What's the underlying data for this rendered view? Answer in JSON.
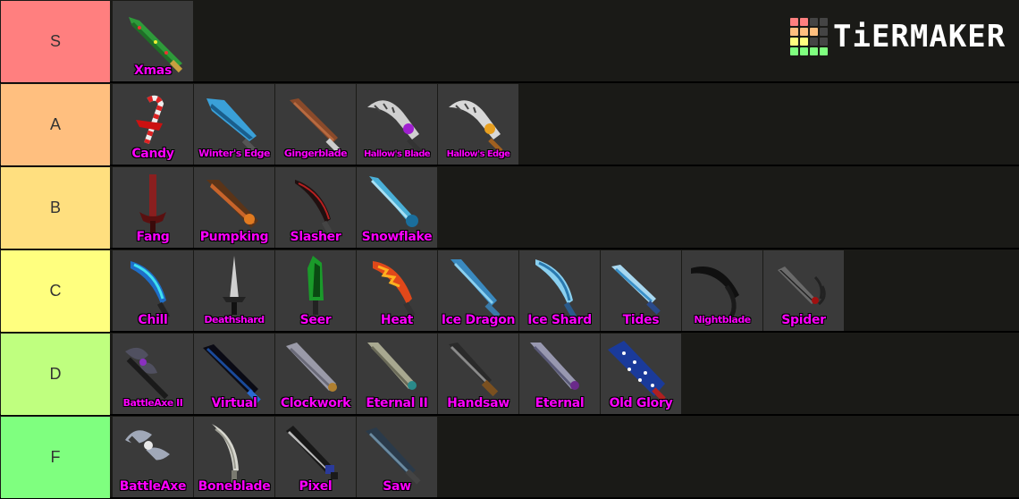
{
  "tiers": [
    {
      "label": "S",
      "color": "#ff7f7f",
      "items": [
        "Xmas"
      ]
    },
    {
      "label": "A",
      "color": "#ffbf7f",
      "items": [
        "Candy",
        "Winter's Edge",
        "Gingerblade",
        "Hallow's Blade",
        "Hallow's Edge"
      ]
    },
    {
      "label": "B",
      "color": "#ffdf7f",
      "items": [
        "Fang",
        "Pumpking",
        "Slasher",
        "Snowflake"
      ]
    },
    {
      "label": "C",
      "color": "#ffff7f",
      "items": [
        "Chill",
        "Deathshard",
        "Seer",
        "Heat",
        "Ice Dragon",
        "Ice Shard",
        "Tides",
        "Nightblade",
        "Spider"
      ]
    },
    {
      "label": "D",
      "color": "#bfff7f",
      "items": [
        "BattleAxe II",
        "Virtual",
        "Clockwork",
        "Eternal II",
        "Handsaw",
        "Eternal",
        "Old Glory"
      ]
    },
    {
      "label": "F",
      "color": "#7fff7f",
      "items": [
        "BattleAxe",
        "Boneblade",
        "Pixel",
        "Saw"
      ]
    }
  ],
  "logo": {
    "text": "TiERMAKER"
  },
  "colors": {
    "item_label": "#ff00ff",
    "item_bg": "#3a3a3a",
    "row_bg": "#1a1a17"
  }
}
